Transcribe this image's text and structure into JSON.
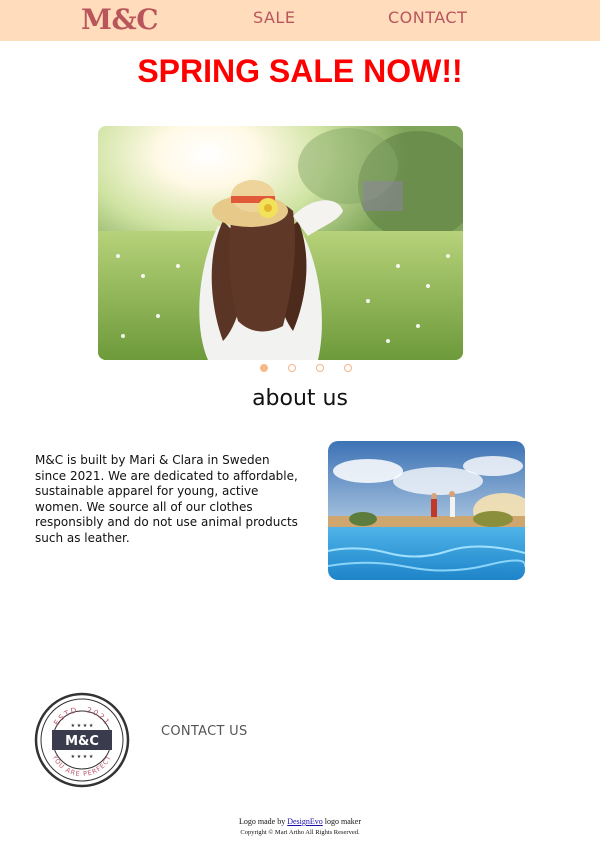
{
  "header": {
    "brand": "M&C",
    "nav": {
      "sale": "SALE",
      "contact": "CONTACT"
    },
    "background": "#ffdcbc",
    "accent": "#b8565c"
  },
  "headline": {
    "text": "SPRING SALE NOW!!",
    "color": "#ff0000"
  },
  "carousel": {
    "image_icon": "hero-photo-woman-in-meadow",
    "slides": 4,
    "active": 0
  },
  "about": {
    "title": "about us",
    "text": "M&C is built by Mari & Clara in Sweden since 2021. We are dedicated to affordable, sustainable apparel for young, active women. We source all of our clothes responsibly and do not use animal products such as leather.",
    "image_icon": "pool-photo"
  },
  "footer": {
    "badge": {
      "top_text": "ESTD. 2021",
      "center_text": "M&C",
      "bottom_text": "YOU ARE PERFECT"
    },
    "contact_us": "CONTACT US",
    "credit_prefix": "Logo made by ",
    "credit_link": "DesignEvo",
    "credit_suffix": " logo maker",
    "copyright": "Copyright © Mari Artho All Rights Reserved."
  }
}
